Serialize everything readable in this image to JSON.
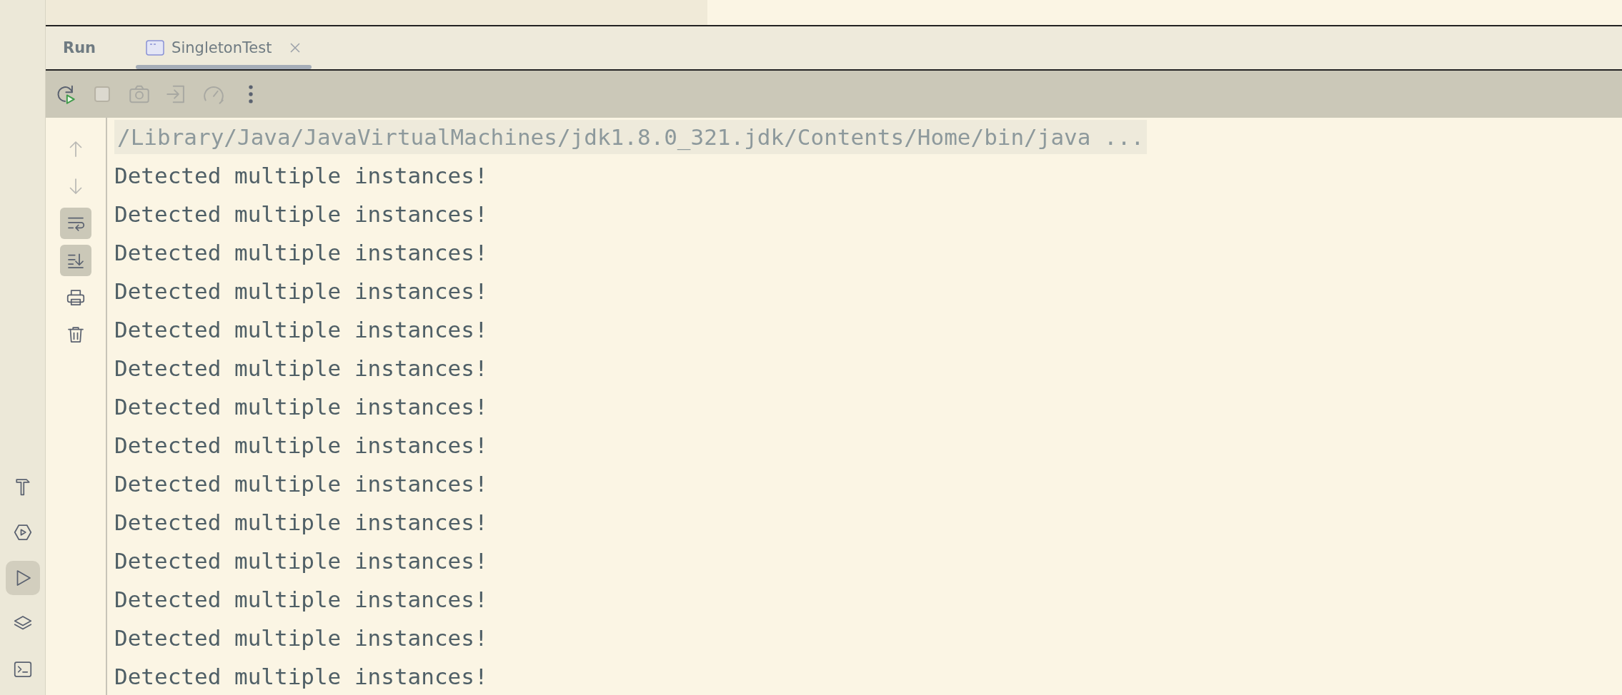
{
  "sidebar": {
    "items": [
      {
        "kind": "build",
        "selected": false
      },
      {
        "kind": "services",
        "selected": false
      },
      {
        "kind": "run",
        "selected": true
      },
      {
        "kind": "layers",
        "selected": false
      },
      {
        "kind": "terminal",
        "selected": false
      }
    ]
  },
  "run_window": {
    "title": "Run",
    "tabs": [
      {
        "label": "SingletonTest",
        "selected": true,
        "closable": true
      }
    ],
    "toolbar": [
      {
        "kind": "rerun",
        "disabled": false
      },
      {
        "kind": "stop",
        "disabled": true
      },
      {
        "kind": "screenshot",
        "disabled": true
      },
      {
        "kind": "attach",
        "disabled": true
      },
      {
        "kind": "profile",
        "disabled": true
      },
      {
        "kind": "more",
        "disabled": false
      }
    ],
    "gutter": [
      {
        "kind": "up",
        "disabled": true,
        "toggled": false
      },
      {
        "kind": "down",
        "disabled": true,
        "toggled": false
      },
      {
        "kind": "wrap",
        "disabled": false,
        "toggled": true
      },
      {
        "kind": "scroll-end",
        "disabled": false,
        "toggled": true
      },
      {
        "kind": "print",
        "disabled": false,
        "toggled": false
      },
      {
        "kind": "clear",
        "disabled": false,
        "toggled": false
      }
    ],
    "console": {
      "command": "/Library/Java/JavaVirtualMachines/jdk1.8.0_321.jdk/Contents/Home/bin/java ...",
      "lines": [
        "Detected multiple instances!",
        "Detected multiple instances!",
        "Detected multiple instances!",
        "Detected multiple instances!",
        "Detected multiple instances!",
        "Detected multiple instances!",
        "Detected multiple instances!",
        "Detected multiple instances!",
        "Detected multiple instances!",
        "Detected multiple instances!",
        "Detected multiple instances!",
        "Detected multiple instances!",
        "Detected multiple instances!",
        "Detected multiple instances!"
      ]
    }
  }
}
